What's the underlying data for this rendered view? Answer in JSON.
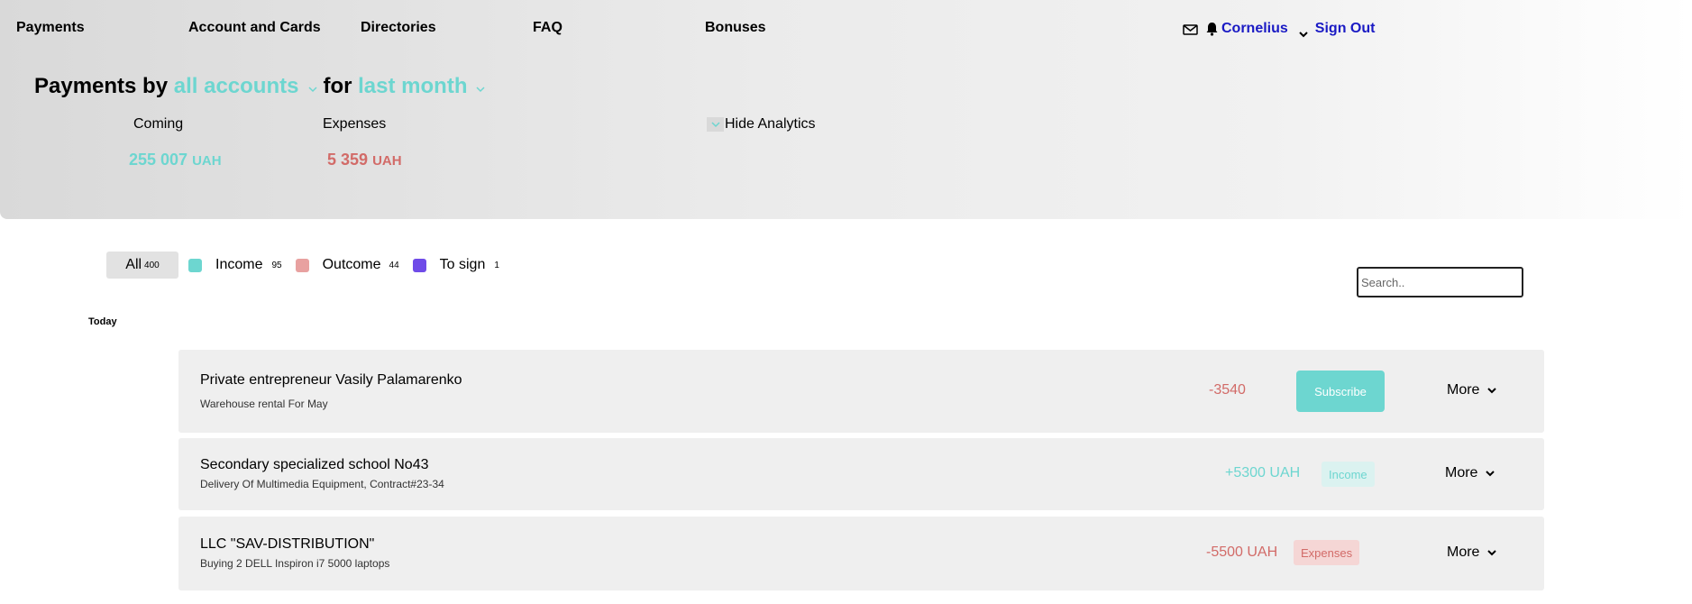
{
  "nav": {
    "payments": "Payments",
    "accounts": "Account and Cards",
    "directories": "Directories",
    "faq": "FAQ",
    "bonuses": "Bonuses"
  },
  "user": {
    "name": "Cornelius",
    "sign_out": "Sign Out",
    "icons": [
      "mail-icon",
      "bell-icon",
      "chevron-down-icon"
    ]
  },
  "title": {
    "prefix": "Payments by",
    "accounts": "all accounts",
    "middle": "for",
    "period": "last month"
  },
  "analytics": {
    "coming_label": "Coming",
    "coming_value": "255 007",
    "coming_unit": "UAH",
    "expenses_label": "Expenses",
    "expenses_value": "5 359",
    "expenses_unit": "UAH",
    "hide_label": "Hide Analytics"
  },
  "filters": {
    "all": {
      "label": "All",
      "count": "400"
    },
    "income": {
      "label": "Income",
      "count": "95",
      "color": "#6dd6d0"
    },
    "outcome": {
      "label": "Outcome",
      "count": "44",
      "color": "#e8a1a0"
    },
    "to_sign": {
      "label": "To sign",
      "count": "1",
      "color": "#6f4be8"
    }
  },
  "search": {
    "placeholder": "Search.."
  },
  "group_label": "Today",
  "payments": [
    {
      "title": "Private entrepreneur Vasily Palamarenko",
      "description": "Warehouse rental For May",
      "amount": "-3540",
      "action": "Subscribe",
      "more": "More"
    },
    {
      "title": "Secondary specialized school No43",
      "description": "Delivery Of Multimedia Equipment, Contract#23-34",
      "amount": "+5300 UAH",
      "badge": "Income",
      "more": "More"
    },
    {
      "title": "LLC \"SAV-DISTRIBUTION\"",
      "description": "Buying 2 DELL Inspiron i7 5000 laptops",
      "amount": "-5500 UAH",
      "badge": "Expenses",
      "more": "More"
    }
  ],
  "colors": {
    "accent": "#6dd6d0",
    "negative": "#d26b68",
    "link": "#1a1ac4"
  }
}
